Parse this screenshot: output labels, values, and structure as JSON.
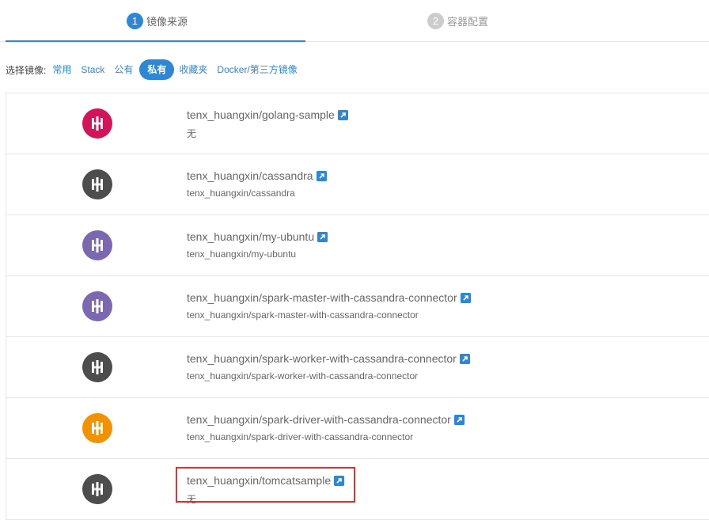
{
  "steps": [
    {
      "num": "1",
      "label": "镜像来源"
    },
    {
      "num": "2",
      "label": "容器配置"
    }
  ],
  "filter": {
    "label": "选择镜像:",
    "tabs": [
      "常用",
      "Stack",
      "公有",
      "私有",
      "收藏夹",
      "Docker/第三方镜像"
    ],
    "active": "私有"
  },
  "images": [
    {
      "name": "tenx_huangxin/golang-sample",
      "desc": "无",
      "icon_color": "#d4145a",
      "icon": "docker-image-icon"
    },
    {
      "name": "tenx_huangxin/cassandra",
      "desc": "tenx_huangxin/cassandra",
      "icon_color": "#4d4d4d",
      "icon": "docker-image-icon"
    },
    {
      "name": "tenx_huangxin/my-ubuntu",
      "desc": "tenx_huangxin/my-ubuntu",
      "icon_color": "#7b68b0",
      "icon": "docker-image-icon"
    },
    {
      "name": "tenx_huangxin/spark-master-with-cassandra-connector",
      "desc": "tenx_huangxin/spark-master-with-cassandra-connector",
      "icon_color": "#7b68b0",
      "icon": "docker-image-icon"
    },
    {
      "name": "tenx_huangxin/spark-worker-with-cassandra-connector",
      "desc": "tenx_huangxin/spark-worker-with-cassandra-connector",
      "icon_color": "#4d4d4d",
      "icon": "docker-image-icon"
    },
    {
      "name": "tenx_huangxin/spark-driver-with-cassandra-connector",
      "desc": "tenx_huangxin/spark-driver-with-cassandra-connector",
      "icon_color": "#f39200",
      "icon": "docker-image-icon"
    },
    {
      "name": "tenx_huangxin/tomcatsample",
      "desc": "无",
      "icon_color": "#4d4d4d",
      "icon": "docker-image-icon"
    }
  ],
  "colors": {
    "accent": "#2d87d5",
    "highlight": "#e03131"
  },
  "link_icon": "external-link-icon"
}
